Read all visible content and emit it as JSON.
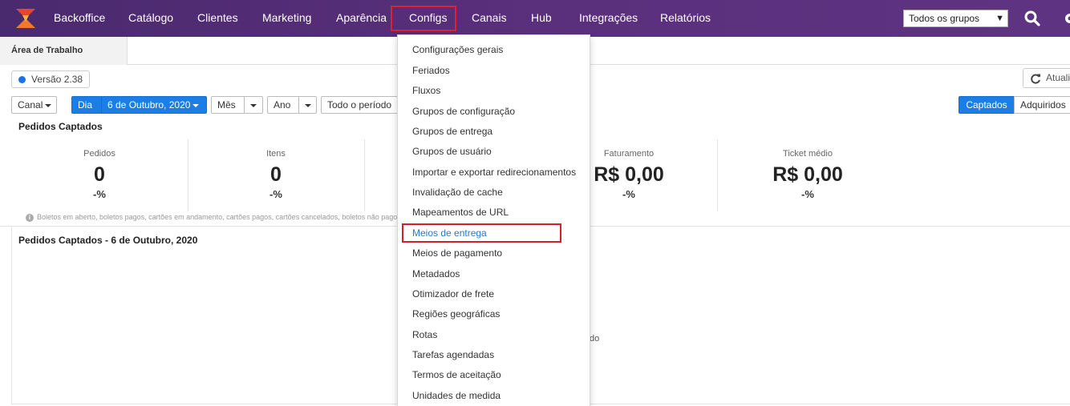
{
  "nav": {
    "items": [
      {
        "label": "Backoffice"
      },
      {
        "label": "Catálogo"
      },
      {
        "label": "Clientes"
      },
      {
        "label": "Marketing"
      },
      {
        "label": "Aparência"
      },
      {
        "label": "Configs"
      },
      {
        "label": "Canais"
      },
      {
        "label": "Hub"
      },
      {
        "label": "Integrações"
      },
      {
        "label": "Relatórios"
      }
    ],
    "group_select": "Todos os grupos",
    "icons": [
      "logo-icon",
      "search-icon",
      "gear-icon"
    ],
    "accent": "#5a2f7c"
  },
  "tabs": {
    "active": "Área de Trabalho"
  },
  "version": "Versão 2.38",
  "refresh_label": "Atualizar",
  "filters": {
    "canal": "Canal",
    "dia": "Dia",
    "date": "6 de Outubro, 2020",
    "mes": "Mês",
    "ano": "Ano",
    "periodo": "Todo o período",
    "captados": "Captados",
    "adquiridos": "Adquiridos"
  },
  "section_title": "Pedidos Captados",
  "metrics": [
    {
      "label": "Pedidos",
      "value": "0",
      "pct": "-%"
    },
    {
      "label": "Itens",
      "value": "0",
      "pct": "-%"
    },
    {
      "label": "Faturamento",
      "value": "R$ 0,00",
      "pct": "-%"
    },
    {
      "label": "Ticket médio",
      "value": "R$ 0,00",
      "pct": "-%"
    }
  ],
  "info_text": "Boletos em aberto, boletos pagos, cartões em andamento, cartões pagos, cartões cancelados, boletos não pagos, pedido",
  "chart_title": "Pedidos Captados - 6 de Outubro, 2020",
  "chart_note": "do",
  "dropdown": {
    "items": [
      {
        "label": "Configurações gerais"
      },
      {
        "label": "Feriados"
      },
      {
        "label": "Fluxos"
      },
      {
        "label": "Grupos de configuração"
      },
      {
        "label": "Grupos de entrega"
      },
      {
        "label": "Grupos de usuário"
      },
      {
        "label": "Importar e exportar redirecionamentos"
      },
      {
        "label": "Invalidação de cache"
      },
      {
        "label": "Mapeamentos de URL"
      },
      {
        "label": "Meios de entrega"
      },
      {
        "label": "Meios de pagamento"
      },
      {
        "label": "Metadados"
      },
      {
        "label": "Otimizador de frete"
      },
      {
        "label": "Regiões geográficas"
      },
      {
        "label": "Rotas"
      },
      {
        "label": "Tarefas agendadas"
      },
      {
        "label": "Termos de aceitação"
      },
      {
        "label": "Unidades de medida"
      }
    ],
    "active_color": "#2a78c8"
  }
}
